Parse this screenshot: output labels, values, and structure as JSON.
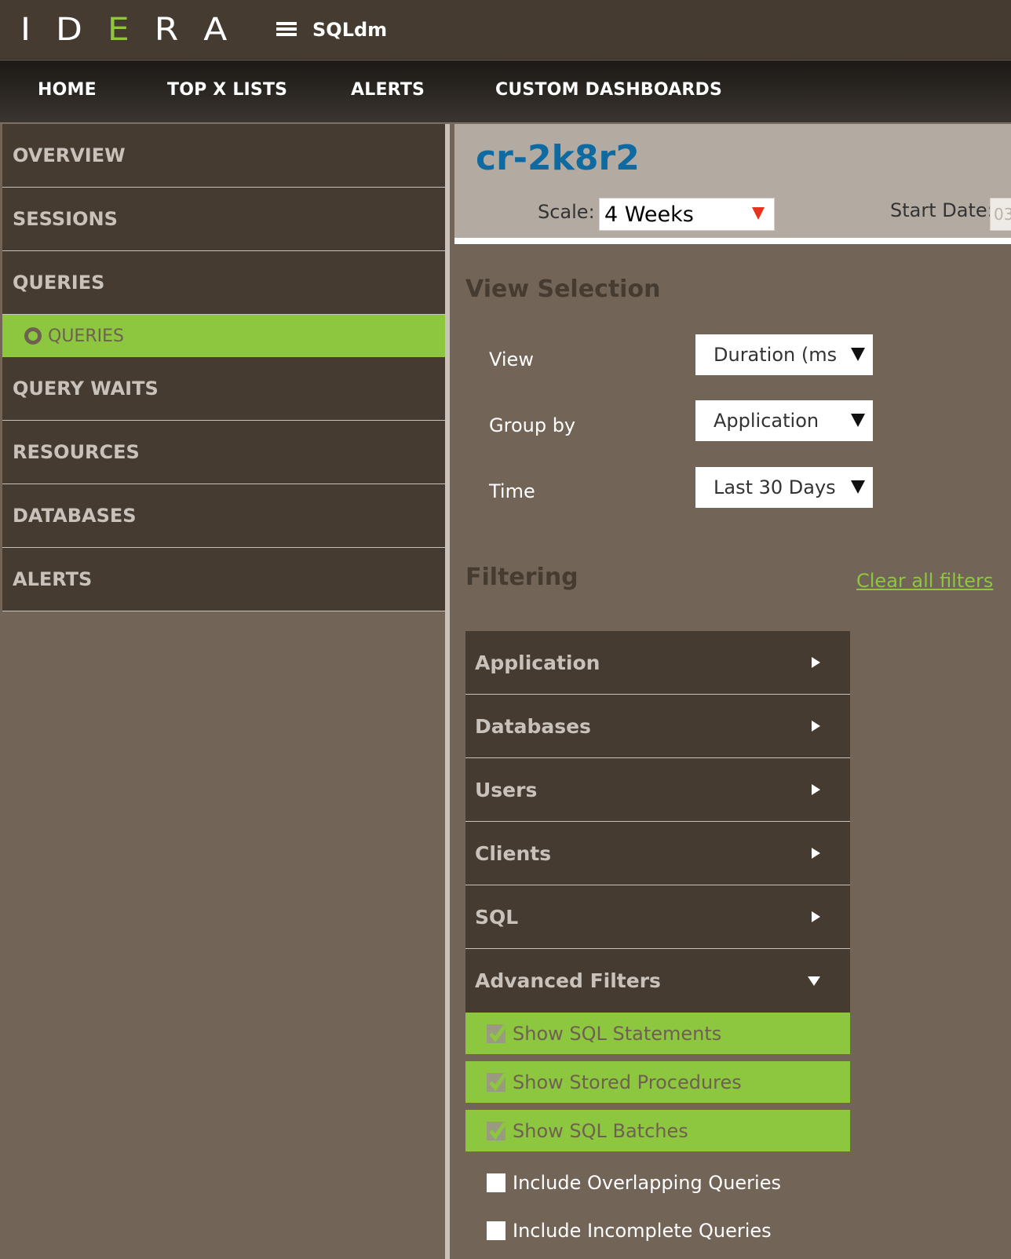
{
  "logo": {
    "letters": [
      "I",
      "D",
      "E",
      "R",
      "A"
    ]
  },
  "product": {
    "name": "SQLdm",
    "menu_icon": "hamburger-icon"
  },
  "main_nav": [
    {
      "label": "HOME"
    },
    {
      "label": "TOP X LISTS"
    },
    {
      "label": "ALERTS"
    },
    {
      "label": "CUSTOM DASHBOARDS"
    }
  ],
  "sidebar": {
    "items": [
      {
        "label": "OVERVIEW"
      },
      {
        "label": "SESSIONS"
      },
      {
        "label": "QUERIES"
      },
      {
        "label": "QUERY WAITS"
      },
      {
        "label": "RESOURCES"
      },
      {
        "label": "DATABASES"
      },
      {
        "label": "ALERTS"
      }
    ],
    "active_sub": {
      "label": "QUERIES",
      "icon": "radio-ring-icon"
    }
  },
  "header": {
    "instance": "cr-2k8r2",
    "scale_label": "Scale:",
    "scale_value": "4 Weeks",
    "start_date_label": "Start Date:",
    "start_date_value": "03"
  },
  "view_selection": {
    "heading": "View Selection",
    "fields": [
      {
        "label": "View",
        "value": "Duration (ms"
      },
      {
        "label": "Group by",
        "value": "Application"
      },
      {
        "label": "Time",
        "value": "Last 30 Days"
      }
    ]
  },
  "filtering": {
    "heading": "Filtering",
    "clear_link": "Clear all filters",
    "groups": [
      {
        "label": "Application",
        "state": "collapsed"
      },
      {
        "label": "Databases",
        "state": "collapsed"
      },
      {
        "label": "Users",
        "state": "collapsed"
      },
      {
        "label": "Clients",
        "state": "collapsed"
      },
      {
        "label": "SQL",
        "state": "collapsed"
      },
      {
        "label": "Advanced Filters",
        "state": "expanded"
      }
    ],
    "advanced": [
      {
        "label": "Show SQL Statements",
        "checked": true
      },
      {
        "label": "Show Stored Procedures",
        "checked": true
      },
      {
        "label": "Show SQL Batches",
        "checked": true
      },
      {
        "label": "Include Overlapping Queries",
        "checked": false
      },
      {
        "label": "Include Incomplete Queries",
        "checked": false
      }
    ]
  },
  "colors": {
    "accent_green": "#8dc63f",
    "panel_dark": "#463b30",
    "panel_mid": "#736458",
    "title_blue": "#0e6aa0",
    "scale_arrow_red": "#e8321e"
  }
}
